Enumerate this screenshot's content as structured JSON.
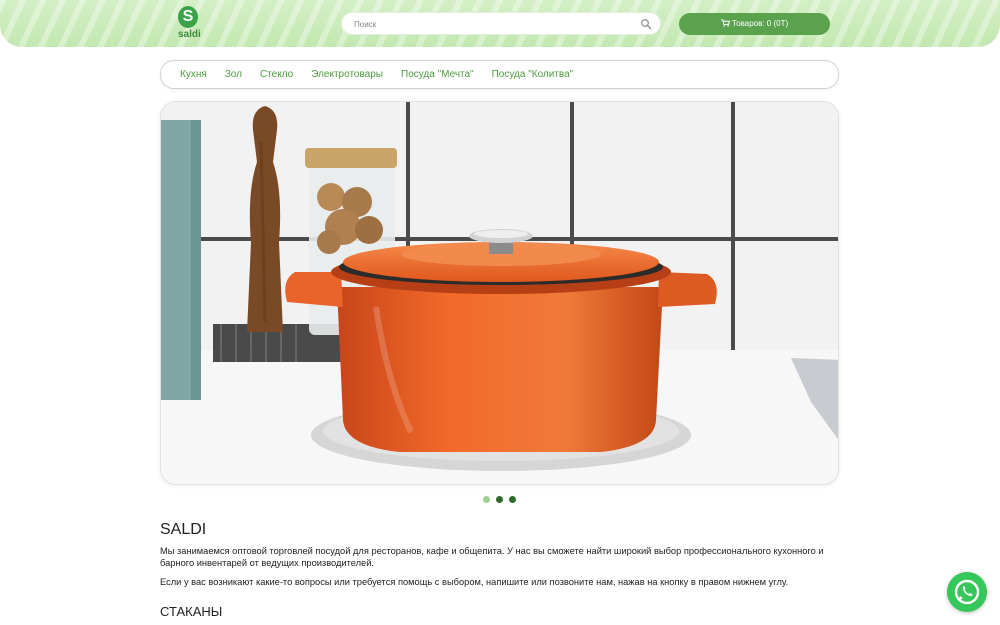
{
  "header": {
    "logo_text": "saldi",
    "logo_mark": "S",
    "search": {
      "placeholder": "Поиск",
      "value": ""
    },
    "cart_label": "Товаров: 0 (0Т)"
  },
  "nav": {
    "items": [
      "Кухня",
      "Зол",
      "Стекло",
      "Электротовары",
      "Посуда \"Мечта\"",
      "Посуда \"Колитва\""
    ]
  },
  "carousel": {
    "active_index": 0,
    "dot_count": 3
  },
  "content": {
    "title": "SALDI",
    "paragraph1": "Мы занимаемся оптовой торговлей посудой для ресторанов, кафе и общепита. У нас вы сможете найти широкий выбор профессионального кухонного и барного инвентарей от ведущих производителей.",
    "paragraph2": "Если у вас возникают какие-то вопросы или требуется помощь с выбором, напишите или позвоните нам, нажав на кнопку в правом нижнем углу.",
    "section_title": "СТАКАНЫ"
  },
  "colors": {
    "accent": "#5aa24e",
    "header_bg": "#c3e8b1",
    "whatsapp": "#35c759"
  },
  "icons": {
    "search": "search-icon",
    "cart": "cart-icon",
    "whatsapp": "whatsapp-icon"
  }
}
